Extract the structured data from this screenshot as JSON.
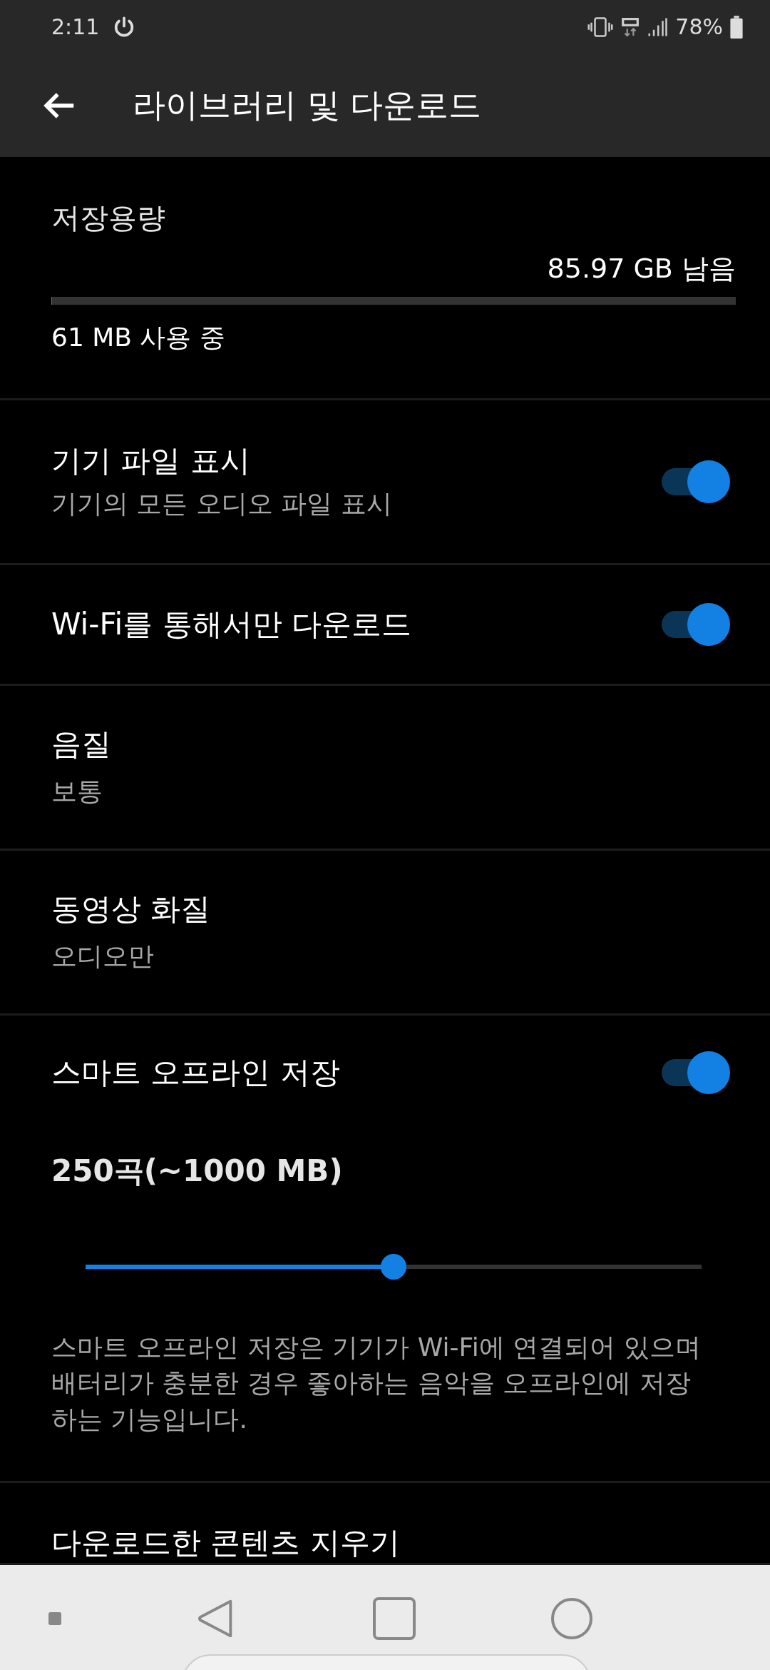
{
  "status_bar": {
    "time": "2:11",
    "battery": "78%"
  },
  "app_bar": {
    "title": "라이브러리 및 다운로드"
  },
  "storage": {
    "title": "저장용량",
    "remaining": "85.97 GB 남음",
    "level": 0.001,
    "used": "61 MB 사용 중"
  },
  "settings": [
    {
      "kind": "toggle",
      "title": "기기 파일 표시",
      "subtitle": "기기의 모든 오디오 파일 표시",
      "on": true
    },
    {
      "kind": "toggle",
      "title": "Wi-Fi를 통해서만 다운로드",
      "on": true
    },
    {
      "kind": "choice",
      "title": "음질",
      "value": "보통"
    },
    {
      "kind": "choice",
      "title": "동영상 화질",
      "value": "오디오만"
    },
    {
      "kind": "smart",
      "title": "스마트 오프라인 저장",
      "on": true,
      "amount": "250곡(~1000 MB)",
      "level": 0.5,
      "description": "스마트 오프라인 저장은 기기가 Wi-Fi에 연결되어 있으며 배터리가 충분한 경우 좋아하는 음악을 오프라인에 저장하는 기능입니다."
    },
    {
      "kind": "action",
      "title": "다운로드한 콘텐츠 지우기"
    }
  ]
}
